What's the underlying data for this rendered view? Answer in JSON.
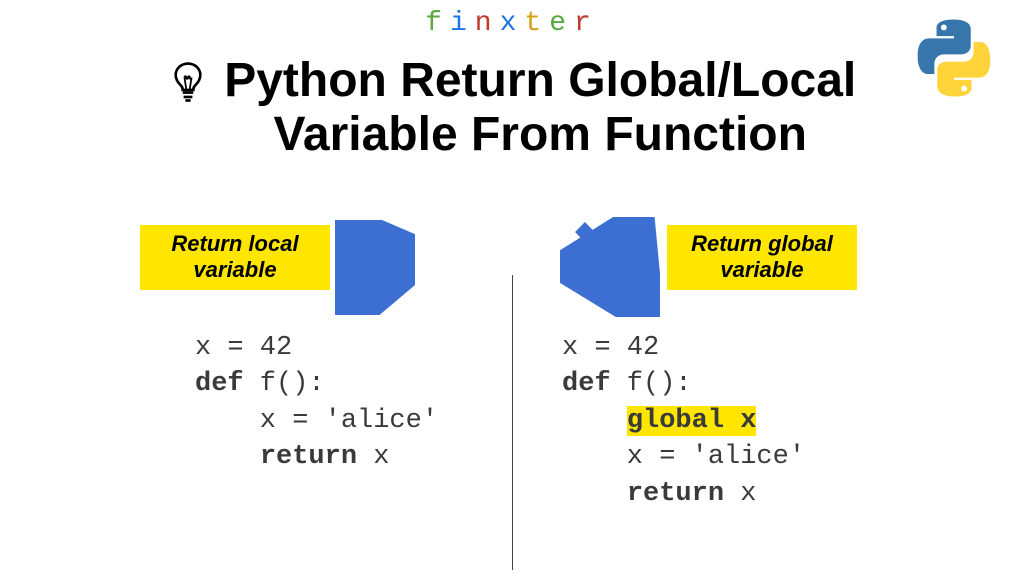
{
  "brand": {
    "letters": [
      "f",
      "i",
      "n",
      "x",
      "t",
      "e",
      "r"
    ]
  },
  "title": {
    "line1": "Python Return Global/Local",
    "line2": "Variable From Function"
  },
  "left": {
    "label_l1": "Return local",
    "label_l2": "variable",
    "code": {
      "l1": "x = 42",
      "l2_kw": "def",
      "l2_rest": " f():",
      "l3": "    x = 'alice'",
      "l4_indent": "    ",
      "l4_kw": "return",
      "l4_rest": " x"
    }
  },
  "right": {
    "label_l1": "Return global",
    "label_l2": "variable",
    "code": {
      "l1": "x = 42",
      "l2_kw": "def",
      "l2_rest": " f():",
      "l3_indent": "    ",
      "l3_hl": "global x",
      "l4": "    x = 'alice'",
      "l5_indent": "    ",
      "l5_kw": "return",
      "l5_rest": " x"
    }
  },
  "icons": {
    "bulb": "bulb-icon",
    "python": "python-logo"
  }
}
